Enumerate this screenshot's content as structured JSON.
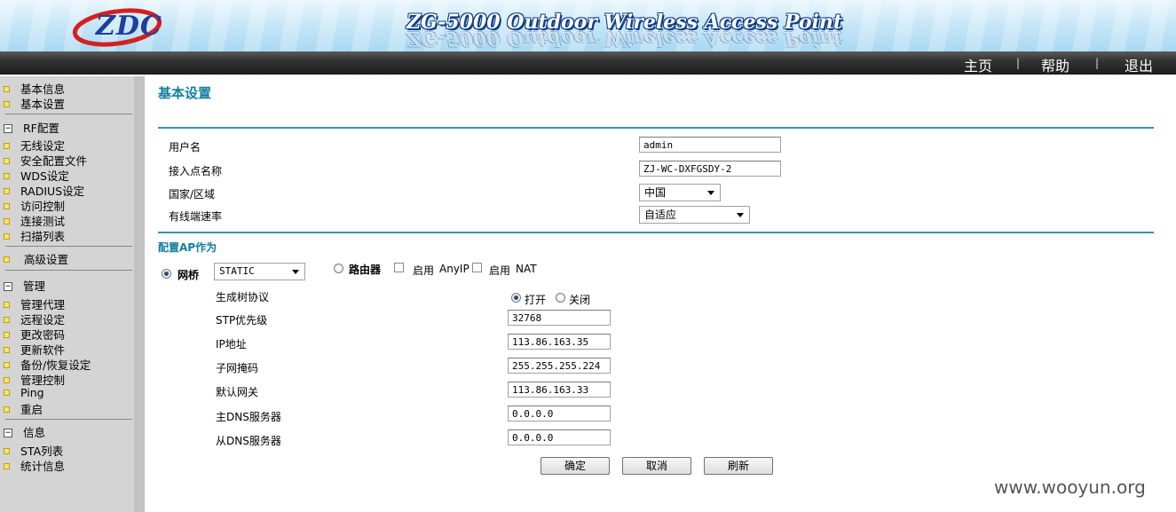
{
  "header": {
    "logo_text": "ZDC",
    "title": "ZG-5000 Outdoor Wireless Access Point"
  },
  "topnav": {
    "home": "主页",
    "help": "帮助",
    "logout": "退出",
    "separator": "|"
  },
  "sidebar": {
    "top_items": [
      "基本信息",
      "基本设置"
    ],
    "rf_group": {
      "label": "RF配置",
      "items": [
        "无线设定",
        "安全配置文件",
        "WDS设定",
        "RADIUS设定",
        "访问控制",
        "连接测试",
        "扫描列表"
      ]
    },
    "advanced": "高级设置",
    "manage_group": {
      "label": "管理",
      "items": [
        "管理代理",
        "远程设定",
        "更改密码",
        "更新软件",
        "备份/恢复设定",
        "管理控制",
        "Ping",
        "重启"
      ]
    },
    "info_group": {
      "label": "信息",
      "items": [
        "STA列表",
        "统计信息"
      ]
    },
    "group_toggle": "−"
  },
  "main": {
    "title": "基本设置",
    "basic": {
      "username_label": "用户名",
      "username_value": "admin",
      "ap_name_label": "接入点名称",
      "ap_name_value": "ZJ-WC-DXFGSDY-2",
      "country_label": "国家/区域",
      "country_value": "中国",
      "wired_rate_label": "有线端速率",
      "wired_rate_value": "自适应"
    },
    "ap_mode": {
      "section_label": "配置AP作为",
      "bridge_label": "网桥",
      "bridge_selected": true,
      "bridge_mode_value": "STATIC",
      "router_label": "路由器",
      "router_selected": false,
      "enable_label_1": "启用",
      "anyip_label": "AnyIP",
      "enable_label_2": "启用",
      "nat_label": "NAT"
    },
    "bridge": {
      "stp_label": "生成树协议",
      "stp_on_label": "打开",
      "stp_off_label": "关闭",
      "stp_on": true,
      "stp_priority_label": "STP优先级",
      "stp_priority_value": "32768",
      "ip_label": "IP地址",
      "ip_value": "113.86.163.35",
      "mask_label": "子网掩码",
      "mask_value": "255.255.255.224",
      "gateway_label": "默认网关",
      "gateway_value": "113.86.163.33",
      "dns1_label": "主DNS服务器",
      "dns1_value": "0.0.0.0",
      "dns2_label": "从DNS服务器",
      "dns2_value": "0.0.0.0"
    },
    "buttons": {
      "ok": "确定",
      "cancel": "取消",
      "refresh": "刷新"
    }
  },
  "watermark": "www.wooyun.org",
  "colors": {
    "accent": "#2f96b3",
    "title": "#0f7fa0",
    "sidebar_bg": "#d4d4d4",
    "navbar_bg": "#333333"
  }
}
